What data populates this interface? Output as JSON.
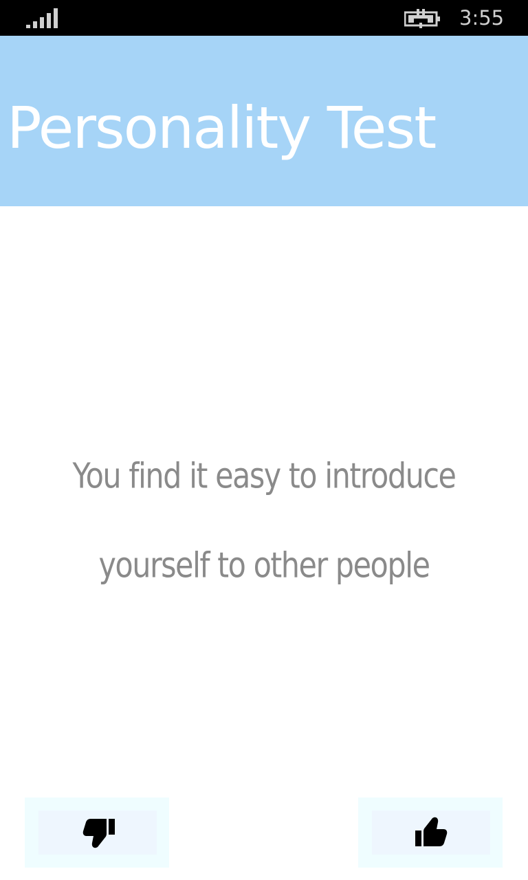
{
  "status_bar": {
    "time": "3:55",
    "signal_icon": "signal-bars-icon",
    "battery_icon": "battery-charging-icon"
  },
  "header": {
    "title": "Personality Test",
    "background_color": "#a6d4f7"
  },
  "question": {
    "text": "You find it easy to introduce yourself to other people"
  },
  "actions": {
    "disagree_icon": "thumbs-down-icon",
    "agree_icon": "thumbs-up-icon"
  }
}
